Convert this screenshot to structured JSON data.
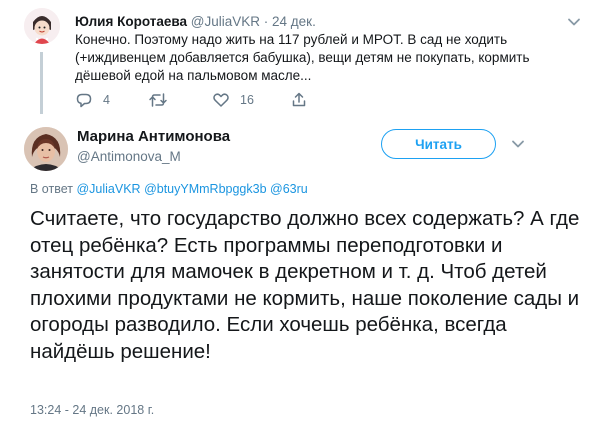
{
  "parent_tweet": {
    "name": "Юлия Коротаева",
    "handle": "@JuliaVKR",
    "separator": "·",
    "date": "24 дек.",
    "text": "Конечно. Поэтому надо жить на 117 рублей и МРОТ. В сад не ходить (+иждивенцем добавляется бабушка), вещи детям не покупать, кормить дёшевой едой на пальмовом масле...",
    "reply_count": "4",
    "retweet_count": "",
    "like_count": "16",
    "icons": [
      "reply-icon",
      "retweet-icon",
      "like-icon",
      "share-icon",
      "chevron-down-icon"
    ]
  },
  "main_tweet": {
    "name": "Марина Антимонова",
    "handle": "@Antimonova_M",
    "follow_label": "Читать",
    "reply_prefix": "В ответ",
    "reply_to": [
      "@JuliaVKR",
      "@btuyYMmRbpggk3b",
      "@63ru"
    ],
    "text": "Считаете, что государство должно всех содержать?  А где отец ребёнка? Есть программы переподготовки и занятости для мамочек в декретном и т. д. Чтоб детей плохими продуктами не кормить, наше поколение сады и огороды разводило. Если хочешь ребёнка, всегда найдёшь решение!",
    "timestamp": "13:24 - 24 дек. 2018 г."
  },
  "colors": {
    "accent": "#1da1f2",
    "link": "#1b95e0",
    "muted": "#657786",
    "text": "#14171a",
    "thread_line": "#c4cfd6"
  }
}
